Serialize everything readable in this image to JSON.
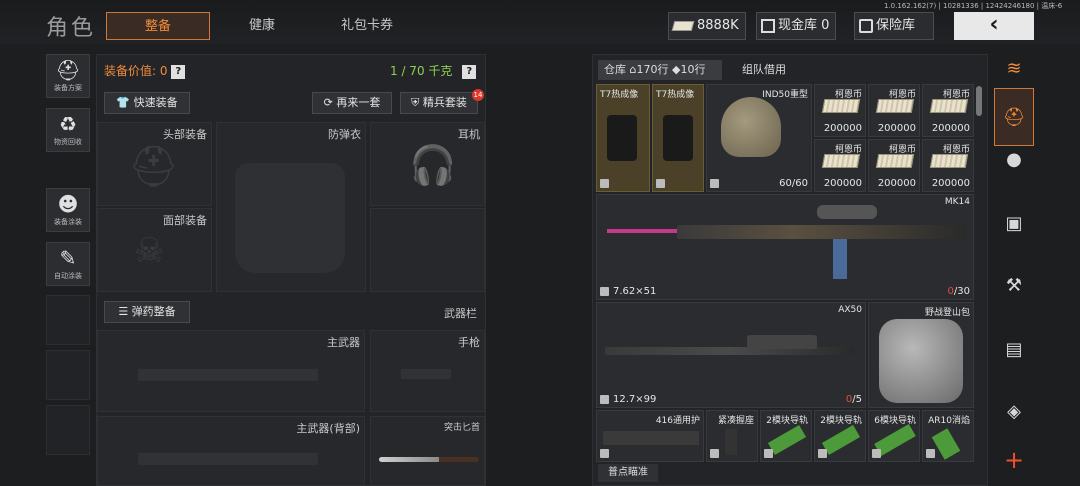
{
  "header": {
    "title": "角色",
    "tabs": [
      "整备",
      "健康",
      "礼包卡券"
    ],
    "version": "1.0.162.162(7) | 10281336 | 12424246180 | 温床-6",
    "currency": "8888K",
    "cash_vault_label": "现金库 0",
    "safe_label": "保险库",
    "back_icon": "‹"
  },
  "left_rail": [
    {
      "icon": "gear-helmet-icon",
      "label": "装备方案"
    },
    {
      "icon": "recycle-icon",
      "label": "物资回收"
    },
    {
      "icon": "paint-icon",
      "label": "装备涂装"
    },
    {
      "icon": "auto-paint-icon",
      "label": "自动涂装"
    }
  ],
  "equipment": {
    "value_label": "装备价值: 0",
    "capacity": "1 / 70 千克",
    "quick_equip": "快速装备",
    "again": "再来一套",
    "elite": "精兵套装",
    "elite_badge": "14",
    "slots": {
      "head": "头部装备",
      "vest": "防弹衣",
      "earphone": "耳机",
      "face": "面部装备",
      "ammo_btn": "弹药整备",
      "weapon_bar": "武器栏",
      "primary": "主武器",
      "pistol": "手枪",
      "primary_back": "主武器(背部)",
      "knife": "突击匕首"
    }
  },
  "warehouse": {
    "tab_label": "仓库",
    "rows_total": "170行",
    "rows_used": "10行",
    "team_borrow": "组队借用",
    "items_row1": [
      {
        "name": "T7热成像",
        "type": "thermal"
      },
      {
        "name": "T7热成像",
        "type": "thermal"
      },
      {
        "name": "IND50重型",
        "durability": "60/60"
      }
    ],
    "money": [
      {
        "name": "柯恩币",
        "amount": "200000"
      },
      {
        "name": "柯恩币",
        "amount": "200000"
      },
      {
        "name": "柯恩币",
        "amount": "200000"
      },
      {
        "name": "柯恩币",
        "amount": "200000"
      },
      {
        "name": "柯恩币",
        "amount": "200000"
      },
      {
        "name": "柯恩币",
        "amount": "200000"
      }
    ],
    "mk14": {
      "name": "MK14",
      "caliber": "7.62×51",
      "ammo_cur": "0",
      "ammo_max": "/30"
    },
    "ax50": {
      "name": "AX50",
      "caliber": "12.7×99",
      "ammo_cur": "0",
      "ammo_max": "/5"
    },
    "backpack": {
      "name": "野战登山包"
    },
    "attachments": [
      "416通用护",
      "紧凑握座",
      "2模块导轨",
      "2模块导轨",
      "6模块导轨",
      "AR10消焰"
    ],
    "bottom_label": "普点瞄准"
  },
  "right_rail": [
    "layers-icon",
    "armor-icon",
    "grenade-icon",
    "medkit-icon",
    "wrench-icon",
    "ammo-box-icon",
    "package-icon",
    "plus-icon"
  ],
  "colors": {
    "accent": "#f08c3c",
    "value_green": "#8fd14f",
    "capacity_green": "#8fd14f",
    "ammo_red": "#e05040"
  }
}
